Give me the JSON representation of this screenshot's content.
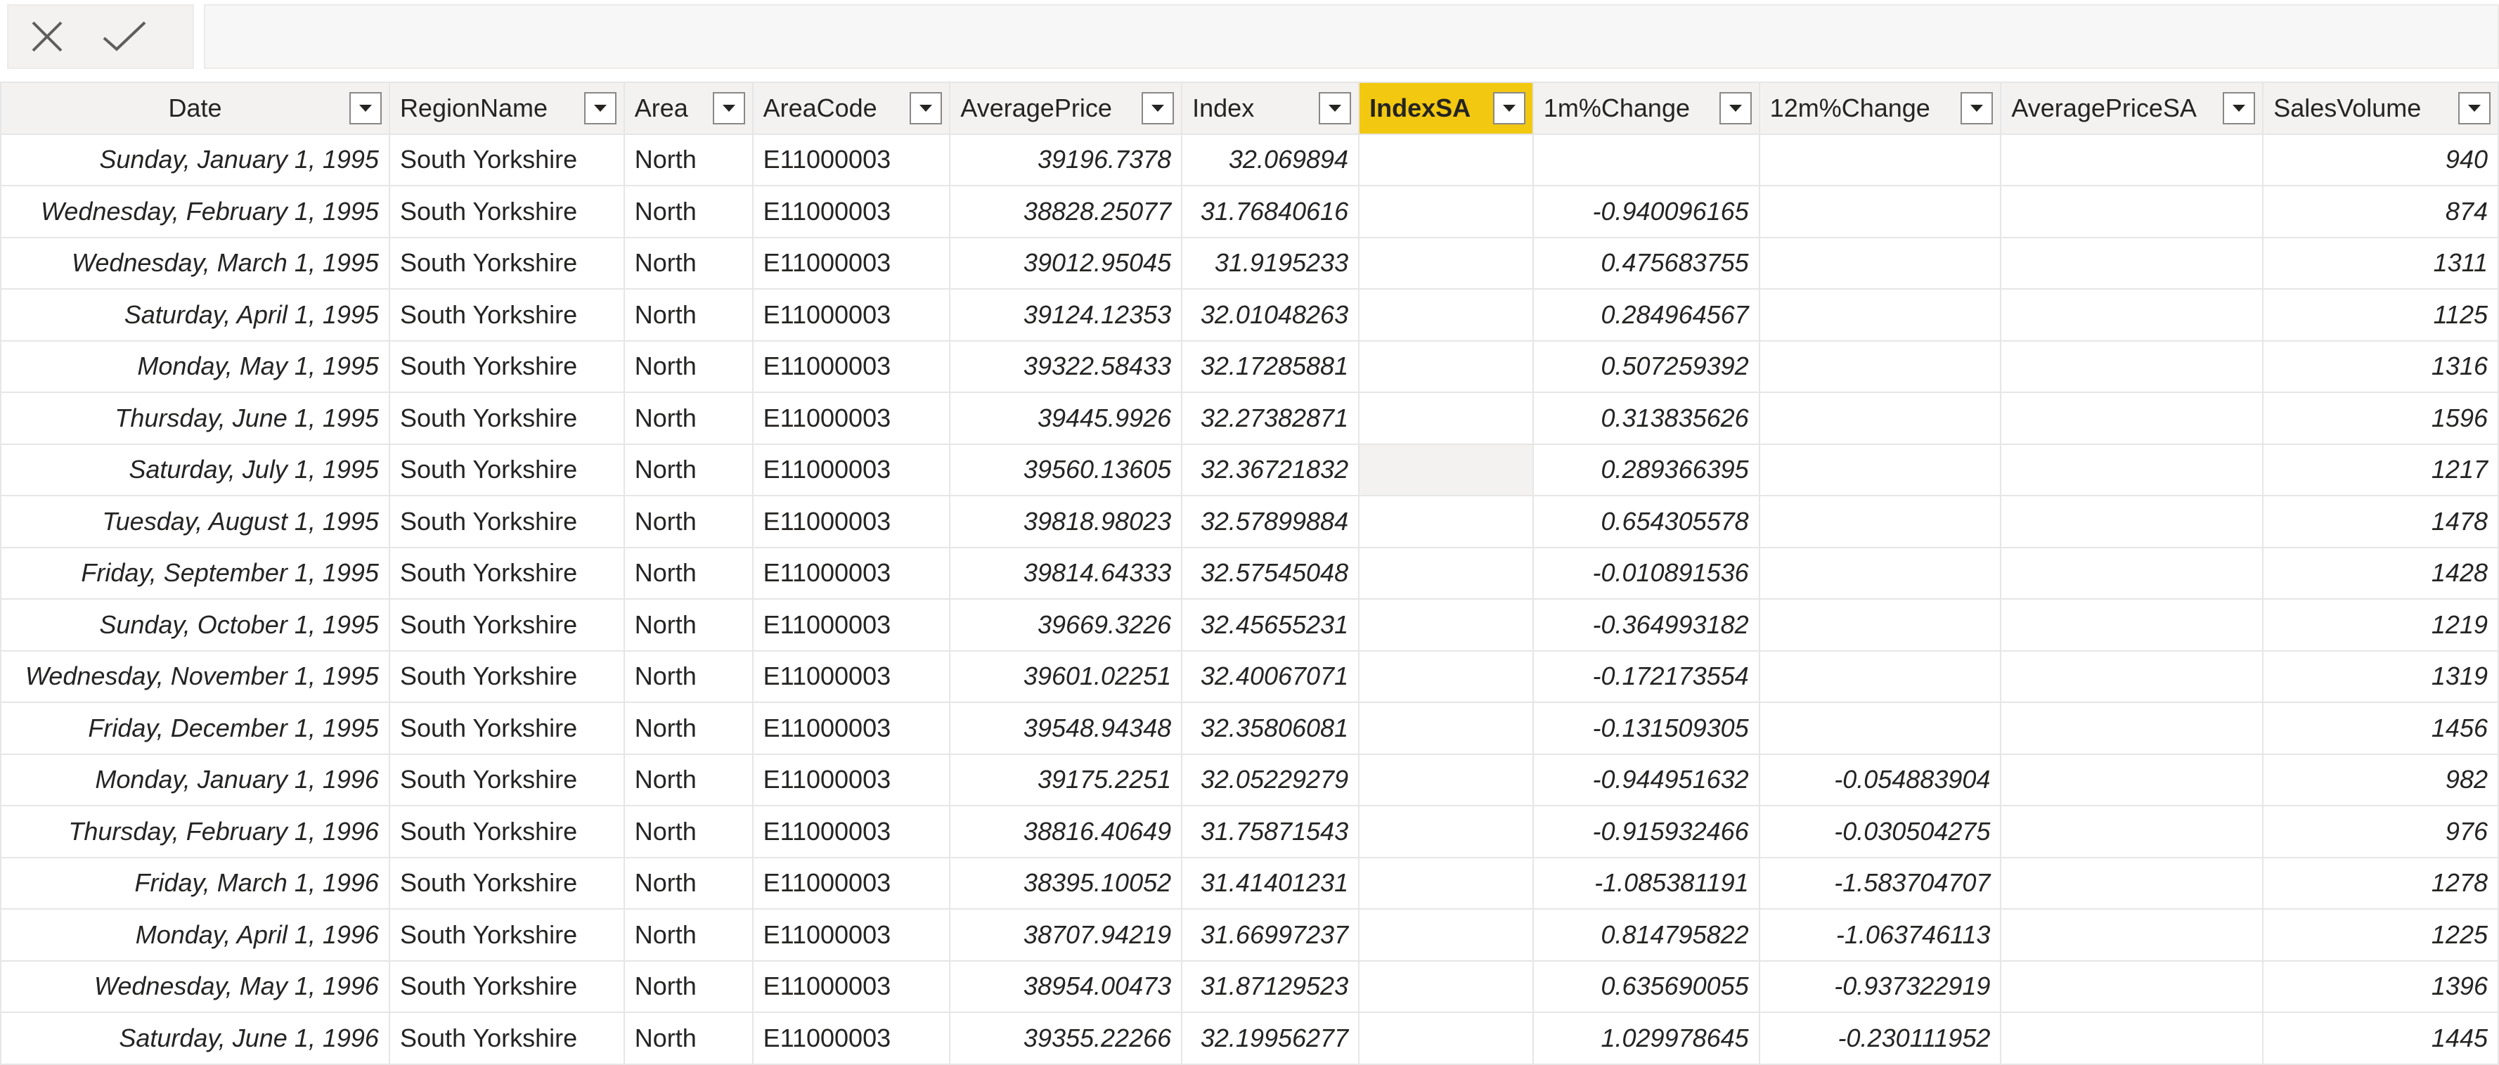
{
  "formula_bar": {
    "cancel_icon": "close-icon",
    "commit_icon": "checkmark-icon",
    "value": ""
  },
  "columns": [
    {
      "label": "Date",
      "align": "date"
    },
    {
      "label": "RegionName",
      "align": "text"
    },
    {
      "label": "Area",
      "align": "text"
    },
    {
      "label": "AreaCode",
      "align": "text"
    },
    {
      "label": "AveragePrice",
      "align": "num"
    },
    {
      "label": "Index",
      "align": "num"
    },
    {
      "label": "IndexSA",
      "align": "num",
      "selected": true
    },
    {
      "label": "1m%Change",
      "align": "num"
    },
    {
      "label": "12m%Change",
      "align": "num"
    },
    {
      "label": "AveragePriceSA",
      "align": "num"
    },
    {
      "label": "SalesVolume",
      "align": "num"
    }
  ],
  "selected_color": "#f2c811",
  "rows": [
    [
      "Sunday, January 1, 1995",
      "South Yorkshire",
      "North",
      "E11000003",
      "39196.7378",
      "32.069894",
      "",
      "",
      "",
      "",
      "940"
    ],
    [
      "Wednesday, February 1, 1995",
      "South Yorkshire",
      "North",
      "E11000003",
      "38828.25077",
      "31.76840616",
      "",
      "-0.940096165",
      "",
      "",
      "874"
    ],
    [
      "Wednesday, March 1, 1995",
      "South Yorkshire",
      "North",
      "E11000003",
      "39012.95045",
      "31.9195233",
      "",
      "0.475683755",
      "",
      "",
      "1311"
    ],
    [
      "Saturday, April 1, 1995",
      "South Yorkshire",
      "North",
      "E11000003",
      "39124.12353",
      "32.01048263",
      "",
      "0.284964567",
      "",
      "",
      "1125"
    ],
    [
      "Monday, May 1, 1995",
      "South Yorkshire",
      "North",
      "E11000003",
      "39322.58433",
      "32.17285881",
      "",
      "0.507259392",
      "",
      "",
      "1316"
    ],
    [
      "Thursday, June 1, 1995",
      "South Yorkshire",
      "North",
      "E11000003",
      "39445.9926",
      "32.27382871",
      "",
      "0.313835626",
      "",
      "",
      "1596"
    ],
    [
      "Saturday, July 1, 1995",
      "South Yorkshire",
      "North",
      "E11000003",
      "39560.13605",
      "32.36721832",
      "",
      "0.289366395",
      "",
      "",
      "1217"
    ],
    [
      "Tuesday, August 1, 1995",
      "South Yorkshire",
      "North",
      "E11000003",
      "39818.98023",
      "32.57899884",
      "",
      "0.654305578",
      "",
      "",
      "1478"
    ],
    [
      "Friday, September 1, 1995",
      "South Yorkshire",
      "North",
      "E11000003",
      "39814.64333",
      "32.57545048",
      "",
      "-0.010891536",
      "",
      "",
      "1428"
    ],
    [
      "Sunday, October 1, 1995",
      "South Yorkshire",
      "North",
      "E11000003",
      "39669.3226",
      "32.45655231",
      "",
      "-0.364993182",
      "",
      "",
      "1219"
    ],
    [
      "Wednesday, November 1, 1995",
      "South Yorkshire",
      "North",
      "E11000003",
      "39601.02251",
      "32.40067071",
      "",
      "-0.172173554",
      "",
      "",
      "1319"
    ],
    [
      "Friday, December 1, 1995",
      "South Yorkshire",
      "North",
      "E11000003",
      "39548.94348",
      "32.35806081",
      "",
      "-0.131509305",
      "",
      "",
      "1456"
    ],
    [
      "Monday, January 1, 1996",
      "South Yorkshire",
      "North",
      "E11000003",
      "39175.2251",
      "32.05229279",
      "",
      "-0.944951632",
      "-0.054883904",
      "",
      "982"
    ],
    [
      "Thursday, February 1, 1996",
      "South Yorkshire",
      "North",
      "E11000003",
      "38816.40649",
      "31.75871543",
      "",
      "-0.915932466",
      "-0.030504275",
      "",
      "976"
    ],
    [
      "Friday, March 1, 1996",
      "South Yorkshire",
      "North",
      "E11000003",
      "38395.10052",
      "31.41401231",
      "",
      "-1.085381191",
      "-1.583704707",
      "",
      "1278"
    ],
    [
      "Monday, April 1, 1996",
      "South Yorkshire",
      "North",
      "E11000003",
      "38707.94219",
      "31.66997237",
      "",
      "0.814795822",
      "-1.063746113",
      "",
      "1225"
    ],
    [
      "Wednesday, May 1, 1996",
      "South Yorkshire",
      "North",
      "E11000003",
      "38954.00473",
      "31.87129523",
      "",
      "0.635690055",
      "-0.937322919",
      "",
      "1396"
    ],
    [
      "Saturday, June 1, 1996",
      "South Yorkshire",
      "North",
      "E11000003",
      "39355.22266",
      "32.19956277",
      "",
      "1.029978645",
      "-0.230111952",
      "",
      "1445"
    ]
  ]
}
